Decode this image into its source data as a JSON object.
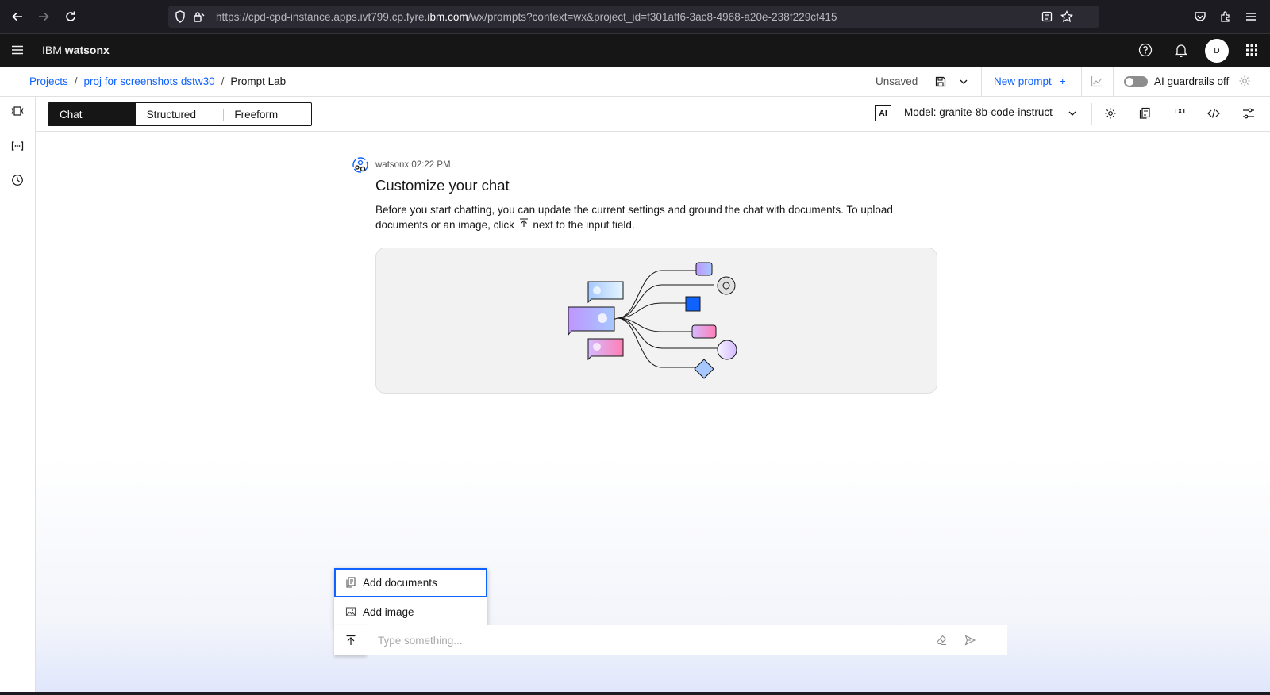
{
  "browser": {
    "url_prefix": "https://cpd-cpd-instance.apps.ivt799.cp.fyre.",
    "url_host": "ibm.com",
    "url_suffix": "/wx/prompts?context=wx&project_id=f301aff6-3ac8-4968-a20e-238f229cf415"
  },
  "header": {
    "brand_prefix": "IBM",
    "brand_name": "watsonx",
    "avatar_initial": "D"
  },
  "breadcrumb": {
    "items": [
      "Projects",
      "proj for screenshots dstw30"
    ],
    "current": "Prompt Lab",
    "separator": "/"
  },
  "actions": {
    "status": "Unsaved",
    "new_prompt": "New prompt",
    "guardrails_label": "AI guardrails off",
    "guardrails_on": false
  },
  "toolbar": {
    "modes": [
      "Chat",
      "Structured",
      "Freeform"
    ],
    "active_mode": "Chat",
    "ai_badge": "AI",
    "model_label": "Model: granite-8b-code-instruct",
    "txt_label": "TXT"
  },
  "message": {
    "meta": "watsonx 02:22 PM",
    "title": "Customize your chat",
    "body_before": "Before you start chatting, you can update the current settings and ground the chat with documents. To upload documents or an image, click",
    "body_after": "next to the input field."
  },
  "upload_menu": {
    "items": [
      "Add documents",
      "Add image"
    ]
  },
  "chat_input": {
    "placeholder": "Type something..."
  },
  "colors": {
    "accent": "#0f62fe",
    "header_bg": "#161616",
    "browser_bg": "#1c1b22"
  }
}
